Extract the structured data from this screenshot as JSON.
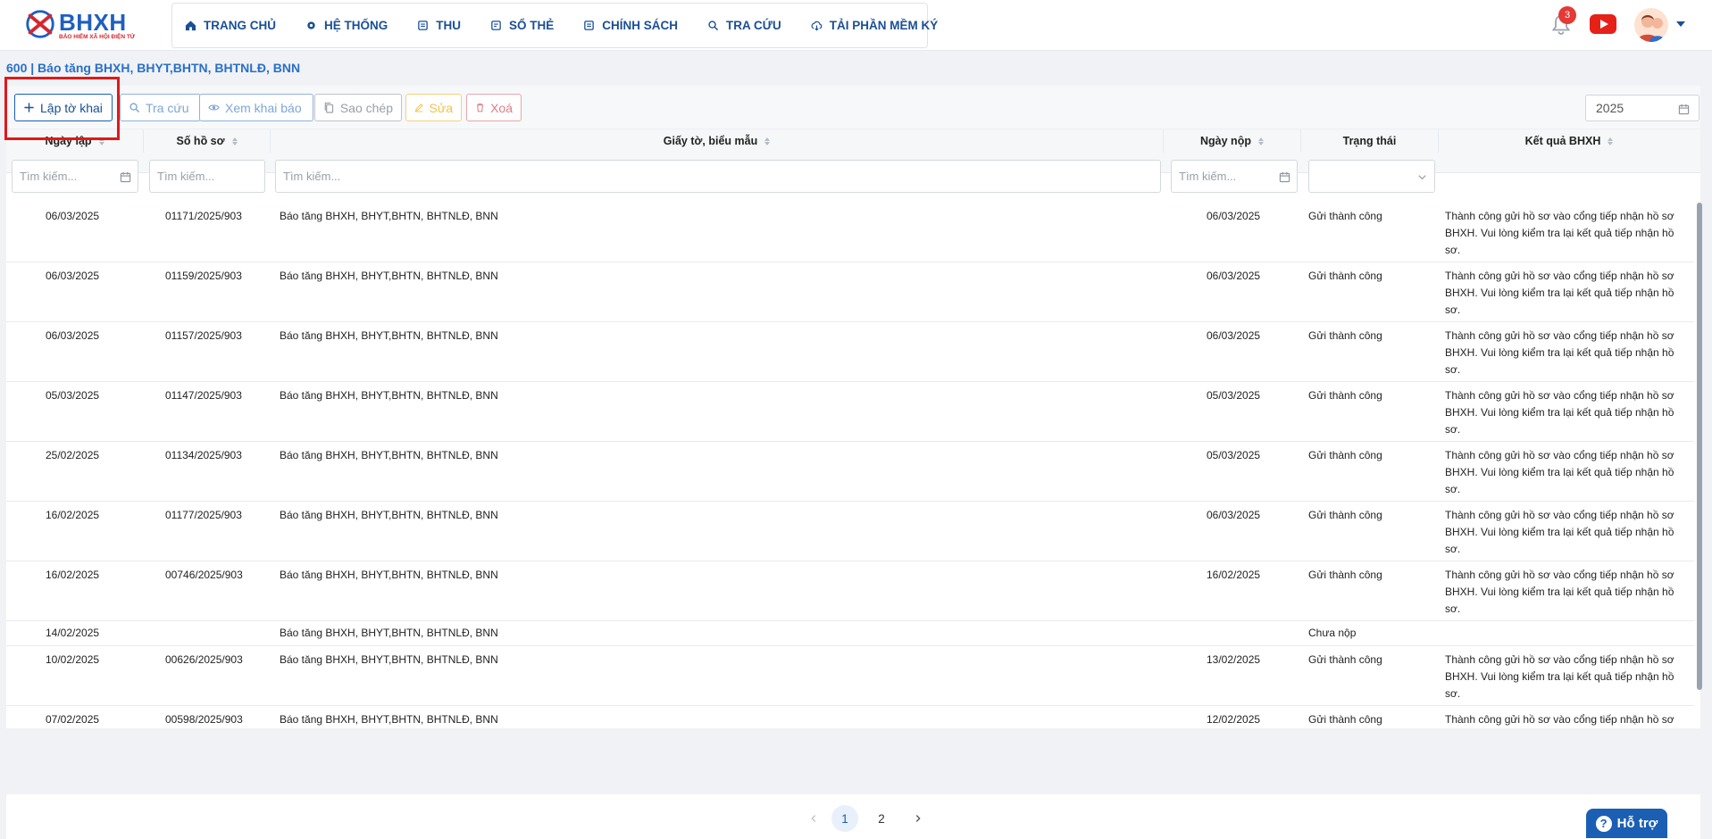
{
  "brand": {
    "name": "BHXH",
    "subtitle": "BẢO HIỂM XÃ HỘI ĐIỆN TỬ",
    "color": "#1f5fbf",
    "accent": "#d6262d"
  },
  "nav": [
    {
      "label": "TRANG CHỦ",
      "icon": "home-icon"
    },
    {
      "label": "HỆ THỐNG",
      "icon": "gear-icon"
    },
    {
      "label": "THU",
      "icon": "document-icon"
    },
    {
      "label": "SỔ THẺ",
      "icon": "card-icon"
    },
    {
      "label": "CHÍNH SÁCH",
      "icon": "policy-icon"
    },
    {
      "label": "TRA CỨU",
      "icon": "search-icon"
    },
    {
      "label": "TẢI PHẦN MỀM KÝ",
      "icon": "cloud-download-icon"
    }
  ],
  "header": {
    "notification_count": "3"
  },
  "page": {
    "title": "600 | Báo tăng BHXH, BHYT,BHTN, BHTNLĐ, BNN"
  },
  "toolbar": {
    "create": "Lập tờ khai",
    "search": "Tra cứu",
    "view": "Xem khai báo",
    "copy": "Sao chép",
    "edit": "Sửa",
    "delete": "Xoá",
    "year": "2025"
  },
  "table": {
    "columns": [
      "Ngày lập",
      "Số hồ sơ",
      "Giấy tờ, biểu mẫu",
      "Ngày nộp",
      "Trạng thái",
      "Kết quả BHXH"
    ],
    "filter_placeholder": "Tìm kiếm...",
    "rows": [
      {
        "ngay_lap": "06/03/2025",
        "so_ho_so": "01171/2025/903",
        "giay_to": "Báo tăng BHXH, BHYT,BHTN, BHTNLĐ, BNN",
        "ngay_nop": "06/03/2025",
        "trang_thai": "Gửi thành công",
        "ket_qua": "Thành công gửi hồ sơ vào cổng tiếp nhận hồ sơ BHXH. Vui lòng kiểm tra lại kết quả tiếp nhận hồ sơ."
      },
      {
        "ngay_lap": "06/03/2025",
        "so_ho_so": "01159/2025/903",
        "giay_to": "Báo tăng BHXH, BHYT,BHTN, BHTNLĐ, BNN",
        "ngay_nop": "06/03/2025",
        "trang_thai": "Gửi thành công",
        "ket_qua": "Thành công gửi hồ sơ vào cổng tiếp nhận hồ sơ BHXH. Vui lòng kiểm tra lại kết quả tiếp nhận hồ sơ."
      },
      {
        "ngay_lap": "06/03/2025",
        "so_ho_so": "01157/2025/903",
        "giay_to": "Báo tăng BHXH, BHYT,BHTN, BHTNLĐ, BNN",
        "ngay_nop": "06/03/2025",
        "trang_thai": "Gửi thành công",
        "ket_qua": "Thành công gửi hồ sơ vào cổng tiếp nhận hồ sơ BHXH. Vui lòng kiểm tra lại kết quả tiếp nhận hồ sơ."
      },
      {
        "ngay_lap": "05/03/2025",
        "so_ho_so": "01147/2025/903",
        "giay_to": "Báo tăng BHXH, BHYT,BHTN, BHTNLĐ, BNN",
        "ngay_nop": "05/03/2025",
        "trang_thai": "Gửi thành công",
        "ket_qua": "Thành công gửi hồ sơ vào cổng tiếp nhận hồ sơ BHXH. Vui lòng kiểm tra lại kết quả tiếp nhận hồ sơ."
      },
      {
        "ngay_lap": "25/02/2025",
        "so_ho_so": "01134/2025/903",
        "giay_to": "Báo tăng BHXH, BHYT,BHTN, BHTNLĐ, BNN",
        "ngay_nop": "05/03/2025",
        "trang_thai": "Gửi thành công",
        "ket_qua": "Thành công gửi hồ sơ vào cổng tiếp nhận hồ sơ BHXH. Vui lòng kiểm tra lại kết quả tiếp nhận hồ sơ."
      },
      {
        "ngay_lap": "16/02/2025",
        "so_ho_so": "01177/2025/903",
        "giay_to": "Báo tăng BHXH, BHYT,BHTN, BHTNLĐ, BNN",
        "ngay_nop": "06/03/2025",
        "trang_thai": "Gửi thành công",
        "ket_qua": "Thành công gửi hồ sơ vào cổng tiếp nhận hồ sơ BHXH. Vui lòng kiểm tra lại kết quả tiếp nhận hồ sơ."
      },
      {
        "ngay_lap": "16/02/2025",
        "so_ho_so": "00746/2025/903",
        "giay_to": "Báo tăng BHXH, BHYT,BHTN, BHTNLĐ, BNN",
        "ngay_nop": "16/02/2025",
        "trang_thai": "Gửi thành công",
        "ket_qua": "Thành công gửi hồ sơ vào cổng tiếp nhận hồ sơ BHXH. Vui lòng kiểm tra lại kết quả tiếp nhận hồ sơ."
      },
      {
        "ngay_lap": "14/02/2025",
        "so_ho_so": "",
        "giay_to": "Báo tăng BHXH, BHYT,BHTN, BHTNLĐ, BNN",
        "ngay_nop": "",
        "trang_thai": "Chưa nộp",
        "ket_qua": ""
      },
      {
        "ngay_lap": "10/02/2025",
        "so_ho_so": "00626/2025/903",
        "giay_to": "Báo tăng BHXH, BHYT,BHTN, BHTNLĐ, BNN",
        "ngay_nop": "13/02/2025",
        "trang_thai": "Gửi thành công",
        "ket_qua": "Thành công gửi hồ sơ vào cổng tiếp nhận hồ sơ BHXH. Vui lòng kiểm tra lại kết quả tiếp nhận hồ sơ."
      },
      {
        "ngay_lap": "07/02/2025",
        "so_ho_so": "00598/2025/903",
        "giay_to": "Báo tăng BHXH, BHYT,BHTN, BHTNLĐ, BNN",
        "ngay_nop": "12/02/2025",
        "trang_thai": "Gửi thành công",
        "ket_qua": "Thành công gửi hồ sơ vào cổng tiếp nhận hồ sơ"
      }
    ]
  },
  "pagination": {
    "pages": [
      "1",
      "2"
    ],
    "current": "1"
  },
  "support": {
    "label": "Hỗ trợ"
  }
}
